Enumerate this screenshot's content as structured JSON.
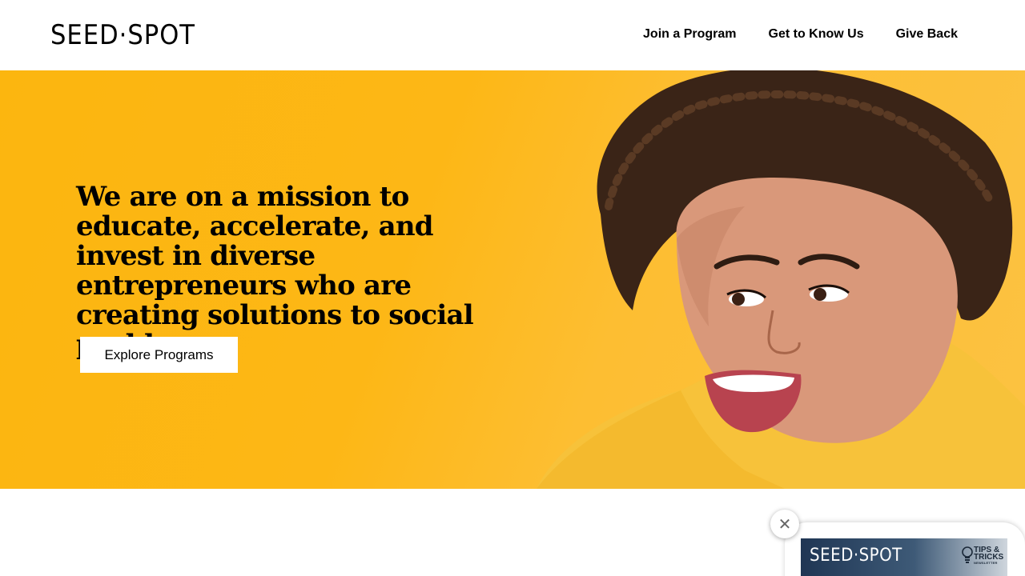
{
  "header": {
    "logo": "SEED·SPOT",
    "nav": [
      "Join a Program",
      "Get to Know Us",
      "Give Back"
    ]
  },
  "hero": {
    "headline": "We are on a mission to educate, accelerate, and invest in diverse entrepreneurs who are creating solutions to social problems.",
    "cta_label": "Explore Programs",
    "image": "smiling-woman-portrait"
  },
  "popup": {
    "close_label": "✕",
    "banner_logo": "SEED·SPOT",
    "banner_tag_line1": "TIPS &",
    "banner_tag_line2": "TRICKS",
    "banner_tag_line3": "NEWSLETTER"
  },
  "colors": {
    "hero_bg": "#fdb716",
    "text": "#000000",
    "banner_dark": "#1f3654"
  }
}
